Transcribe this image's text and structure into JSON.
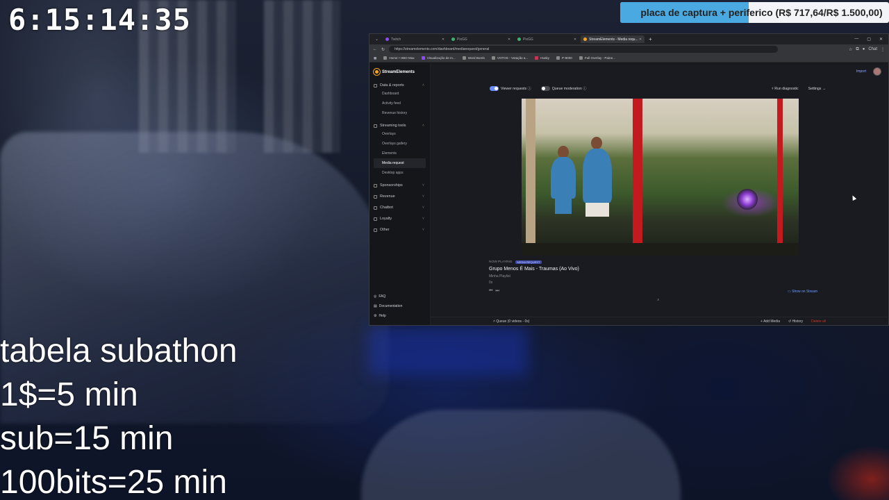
{
  "overlay": {
    "timer": "6:15:14:35",
    "goal": {
      "text": "placa de captura + periferico (R$ 717,64/R$ 1.500,00)",
      "progress_fraction": 0.4784,
      "fill_color": "#4aa9e0"
    },
    "subathon": {
      "title": "tabela subathon",
      "lines": [
        "1$=5 min",
        "sub=15 min",
        "100bits=25 min"
      ]
    }
  },
  "browser": {
    "tabs": [
      {
        "label": "Twitch",
        "active": false
      },
      {
        "label": "PixGG",
        "active": false
      },
      {
        "label": "PixGG",
        "active": false
      },
      {
        "label": "StreamElements - Media requ...",
        "active": true
      }
    ],
    "new_tab": "+",
    "url": "https://streamelements.com/dashboard/mediarequest/general",
    "bookmarks": [
      "Home • HBO Max",
      "Visualização de m...",
      "Word Bomb",
      "VOTOS - Votação a...",
      "Husky",
      "P-9000",
      "Full Overlay - Paine..."
    ],
    "profile": "Chat"
  },
  "streamelements": {
    "logo": "StreamElements",
    "nav": [
      {
        "group": "Data & reports",
        "items": [
          "Dashboard",
          "Activity feed",
          "Revenue history"
        ]
      },
      {
        "group": "Streaming tools",
        "items": [
          "Overlays",
          "Overlays gallery",
          "Elements",
          "Media request",
          "Desktop apps"
        ]
      },
      {
        "group": "Sponsorships",
        "items": []
      },
      {
        "group": "Revenue",
        "items": []
      },
      {
        "group": "Chatbot",
        "items": []
      },
      {
        "group": "Loyalty",
        "items": []
      },
      {
        "group": "Other",
        "items": []
      }
    ],
    "active_item": "Media request",
    "footer": [
      "FAQ",
      "Documentation",
      "Help"
    ],
    "import": "Import",
    "controls": {
      "viewer_requests": "Viewer requests",
      "queue_moderation": "Queue moderation",
      "run_diagnostic": "Run diagnostic",
      "settings": "Settings"
    },
    "now_playing": {
      "label": "NOW PLAYING",
      "badge": "MEDIA REQUEST",
      "title": "Grupo Menos É Mais - Traumas (Ao Vivo)",
      "subtitle": "Minha Playlist",
      "time": "0s"
    },
    "show_on_stream": "Show on Stream",
    "queue": {
      "label": "Queue (0 videos - 0s)",
      "add_media": "Add Media",
      "history": "History",
      "delete": "Delete all"
    }
  }
}
